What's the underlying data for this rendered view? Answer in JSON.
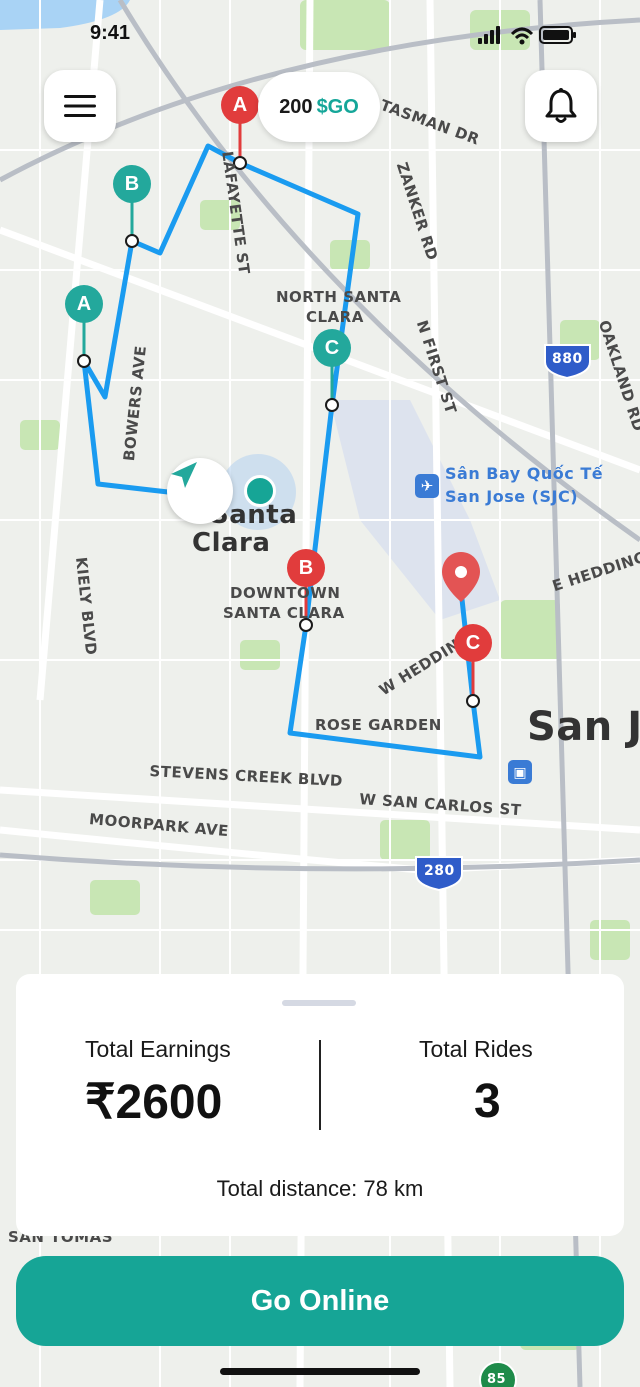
{
  "status_bar": {
    "time": "9:41"
  },
  "header": {
    "menu_icon": "hamburger-menu-icon",
    "balance_amount": "200",
    "balance_token": "$GO",
    "notification_icon": "bell-icon"
  },
  "map": {
    "labels": {
      "north_santa_clara": "NORTH SANTA",
      "north_santa_clara_2": "CLARA",
      "santa_clara": "Santa",
      "santa_clara_2": "Clara",
      "downtown": "DOWNTOWN",
      "downtown_2": "SANTA CLARA",
      "rose_garden": "ROSE GARDEN",
      "stevens_creek": "STEVENS CREEK BLVD",
      "w_san_carlos": "W SAN CARLOS ST",
      "moorpark": "MOORPARK AVE",
      "bowers": "BOWERS AVE",
      "kiely": "KIELY BLVD",
      "lafayette": "LAFAYETTE ST",
      "zanker": "ZANKER RD",
      "n_first": "N FIRST ST",
      "oakland": "OAKLAND RD",
      "tasman": "TASMAN DR",
      "w_hedding": "W HEDDING",
      "e_hedding": "E HEDDING S",
      "airport": "Sân Bay Quốc Tế",
      "airport_2": "San Jose (SJC)",
      "san_jose": "San J",
      "san_tomas": "SAN TOMAS",
      "highway_880": "880",
      "highway_280": "280",
      "highway_85": "85"
    },
    "pins": {
      "teal_b": "B",
      "teal_a": "A",
      "teal_c": "C",
      "red_a": "A",
      "red_b": "B",
      "red_c": "C"
    }
  },
  "summary": {
    "earnings_label": "Total Earnings",
    "earnings_value": "₹2600",
    "rides_label": "Total Rides",
    "rides_value": "3",
    "distance_text": "Total distance: 78 km"
  },
  "cta": {
    "label": "Go Online"
  },
  "colors": {
    "accent": "#16a596",
    "route": "#1a9bf0",
    "pin_red": "#e13c3c",
    "pin_teal": "#23a89c"
  }
}
